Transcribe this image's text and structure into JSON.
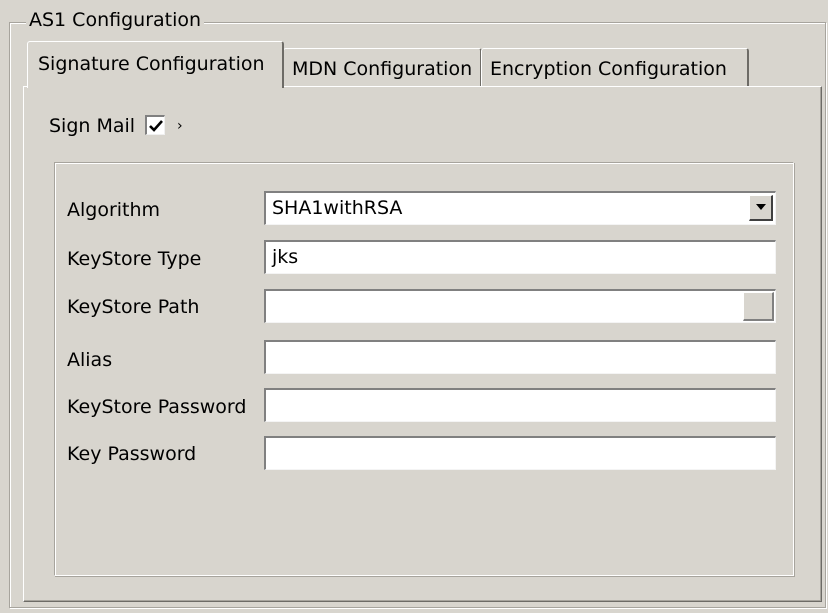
{
  "group": {
    "title": "AS1 Configuration"
  },
  "tabs": [
    {
      "label": "Signature Configuration",
      "active": true
    },
    {
      "label": "MDN Configuration",
      "active": false
    },
    {
      "label": "Encryption Configuration",
      "active": false
    }
  ],
  "sign_mail": {
    "label": "Sign Mail",
    "checked": true,
    "trailing_mark": "›"
  },
  "form": {
    "algorithm": {
      "label": "Algorithm",
      "value": "SHA1withRSA",
      "control": "dropdown"
    },
    "keystore_type": {
      "label": "KeyStore Type",
      "value": "jks"
    },
    "keystore_path": {
      "label": "KeyStore Path",
      "value": "",
      "control": "file-browse"
    },
    "alias": {
      "label": "Alias",
      "value": ""
    },
    "keystore_password": {
      "label": "KeyStore Password",
      "value": ""
    },
    "key_password": {
      "label": "Key Password",
      "value": ""
    }
  },
  "icons": {
    "checkbox_mark": "checkmark-icon",
    "dropdown": "chevron-down-icon"
  },
  "colors": {
    "background": "#d8d5ce",
    "field_background": "#ffffff",
    "shadow": "#808080",
    "highlight": "#ffffff"
  }
}
